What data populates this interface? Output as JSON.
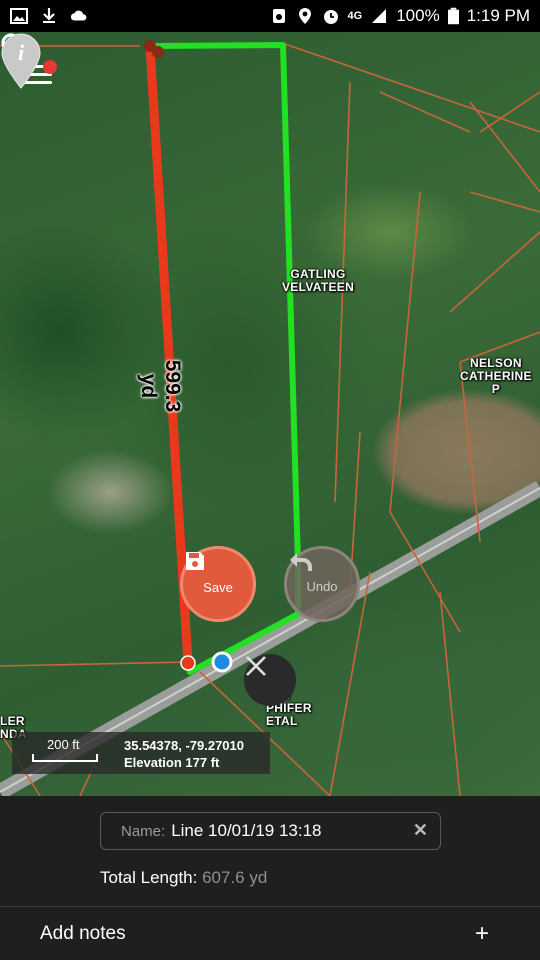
{
  "status_bar": {
    "network": "4G",
    "battery": "100%",
    "time": "1:19 PM"
  },
  "map": {
    "parcel_labels": [
      "GATLING\nVELVATEEN",
      "NELSON\nCATHERINE\nP",
      "ELL\nNDY\nPHIFER\nETAL",
      "LER\nNDA"
    ],
    "segment_length": "599.3 yd",
    "save_label": "Save",
    "undo_label": "Undo",
    "scale_label": "200 ft",
    "coordinates": "35.54378, -79.27010",
    "elevation": "Elevation 177 ft",
    "icons": {
      "menu": "menu-icon",
      "search": "search-icon",
      "save": "floppy-disk-icon",
      "undo": "undo-arrow-icon",
      "close": "close-icon",
      "info": "info-pin-icon"
    },
    "colors": {
      "selected_line": "#e8391d",
      "shape_line": "#22e022",
      "parcel_border": "#c8653a",
      "save": "#e05a3b"
    }
  },
  "panel": {
    "name_label": "Name:",
    "name_value": "Line 10/01/19 13:18",
    "total_label": "Total Length:",
    "total_value": "607.6 yd",
    "notes_label": "Add notes",
    "plus": "+",
    "clear": "✕"
  }
}
